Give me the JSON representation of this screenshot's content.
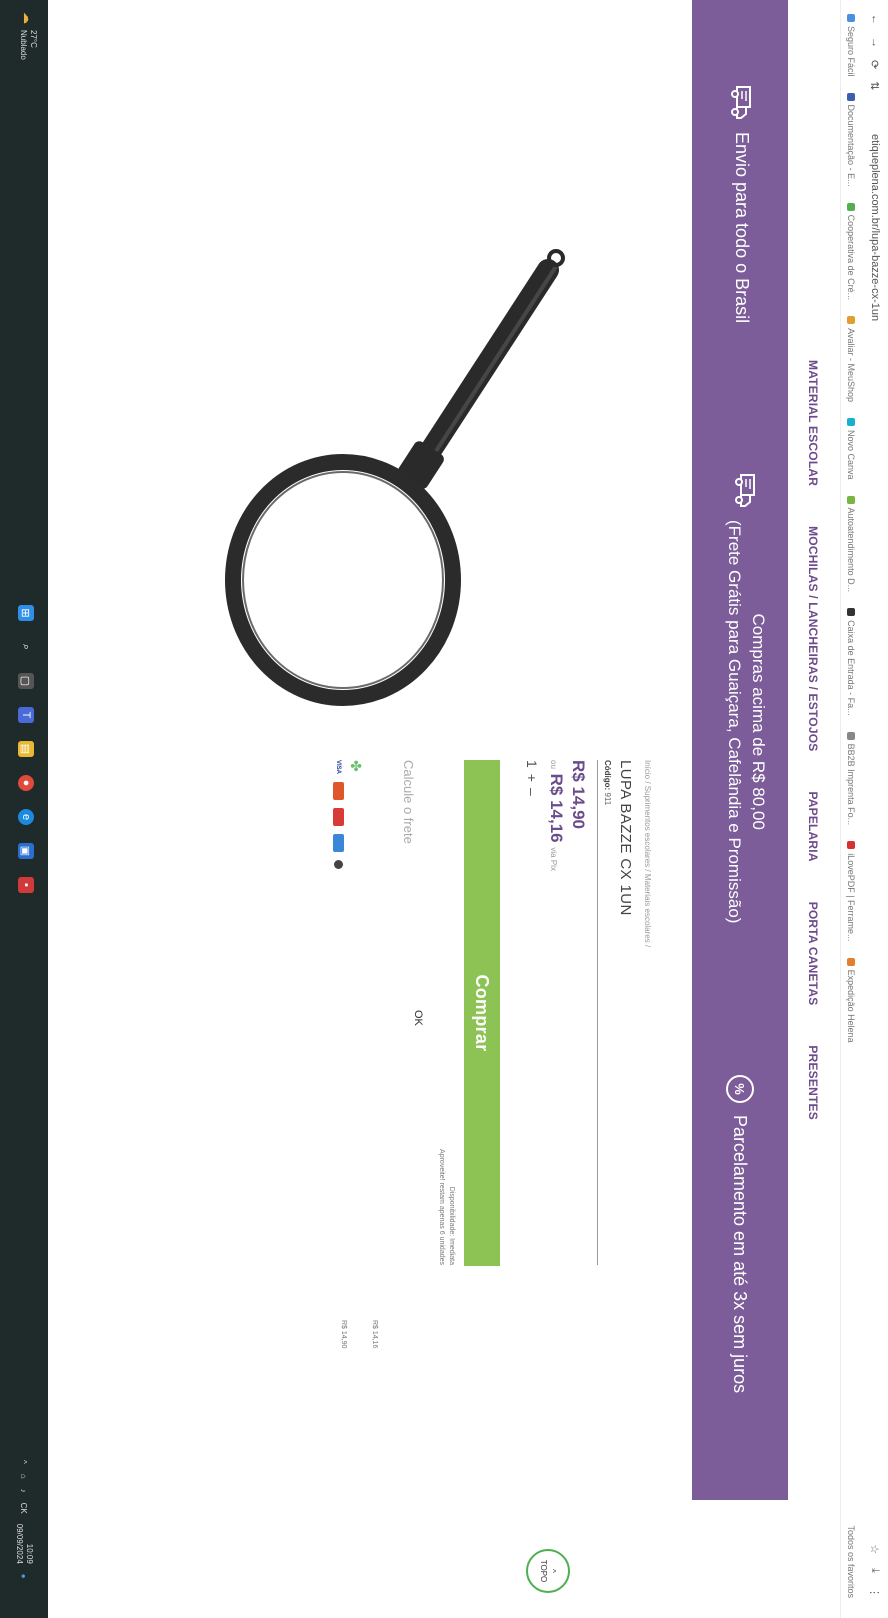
{
  "browser": {
    "url": "etiqueplena.com.br/lupa-bazze-cx-1un",
    "right_label": "Todos os favoritos"
  },
  "bookmarks": [
    {
      "label": "Seguro Fácil",
      "color": "#4a8fe0"
    },
    {
      "label": "Documentação - E...",
      "color": "#3b5fae"
    },
    {
      "label": "Cooperativa de Cré...",
      "color": "#52b050"
    },
    {
      "label": "Avaliar - MeuShop",
      "color": "#e0a030"
    },
    {
      "label": "Novo Canva",
      "color": "#18b0d0"
    },
    {
      "label": "Autoatendimento D...",
      "color": "#79b540"
    },
    {
      "label": "Caixa de Entrada - Fa...",
      "color": "#333333"
    },
    {
      "label": "BB2B Imprenta Fo...",
      "color": "#888888"
    },
    {
      "label": "iLovePDF | Ferrame...",
      "color": "#d93030"
    },
    {
      "label": "Expedição Helena",
      "color": "#e08030"
    }
  ],
  "nav": {
    "items": [
      "MATERIAL ESCOLAR",
      "MOCHILAS / LANCHEIRAS / ESTOJOS",
      "PAPELARIA",
      "PORTA CANETAS",
      "PRESENTES"
    ]
  },
  "banner": {
    "shipping": "Envio para todo o Brasil",
    "free_line1": "Compras acima de R$ 80,00",
    "free_line2": "(Frete Grátis para Guaiçara, Cafelândia e Promissão)",
    "installments": "Parcelamento em até 3x sem juros",
    "color": "#7c5c99"
  },
  "product": {
    "breadcrumb": "Início / Suprimentos escolares / Materiais escolares /",
    "title": "LUPA BAZZE CX 1UN",
    "code_label": "Código:",
    "code": "911",
    "price": "R$ 14,90",
    "price_alt_prefix": "ou",
    "price_alt": "R$ 14,16",
    "price_alt_suffix": "via Pix",
    "qty_plus": "+",
    "qty_value": "1",
    "qty_minus": "–",
    "buy_label": "Comprar",
    "buy_color": "#8dc355",
    "note_line1": "Disponibilidade: Imediata",
    "note_line2": "Aproveite! restam apenas 6 unidades",
    "shipping_calc": "Calcule o frete",
    "ok_label": "OK",
    "side_price1": "R$ 14,16",
    "side_price2": "R$ 14,90",
    "visa": "VISA"
  },
  "topo_label": "TOPO",
  "taskbar": {
    "temp": "27°C",
    "weather": "Nublado",
    "lang": "CK",
    "time": "10:09",
    "date": "09/09/2024"
  }
}
